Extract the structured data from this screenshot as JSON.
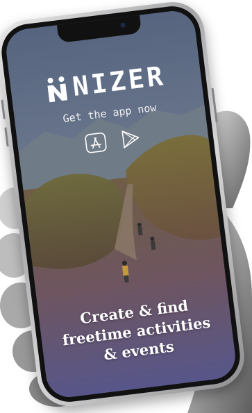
{
  "brand": {
    "name": "NIZER",
    "logo_icon": "nizer-figures-logo-icon"
  },
  "tagline": "Get the app now",
  "stores": [
    {
      "name": "App Store",
      "icon": "app-store-icon"
    },
    {
      "name": "Google Play",
      "icon": "google-play-icon"
    }
  ],
  "headline": {
    "line1": "Create & find",
    "line2": "freetime activities",
    "line3": "& events"
  },
  "colors": {
    "text": "#ffffff",
    "screen_top": "#5d6c84",
    "screen_bottom": "#5a5a8a",
    "phone_frame": "#b5b5b8"
  }
}
